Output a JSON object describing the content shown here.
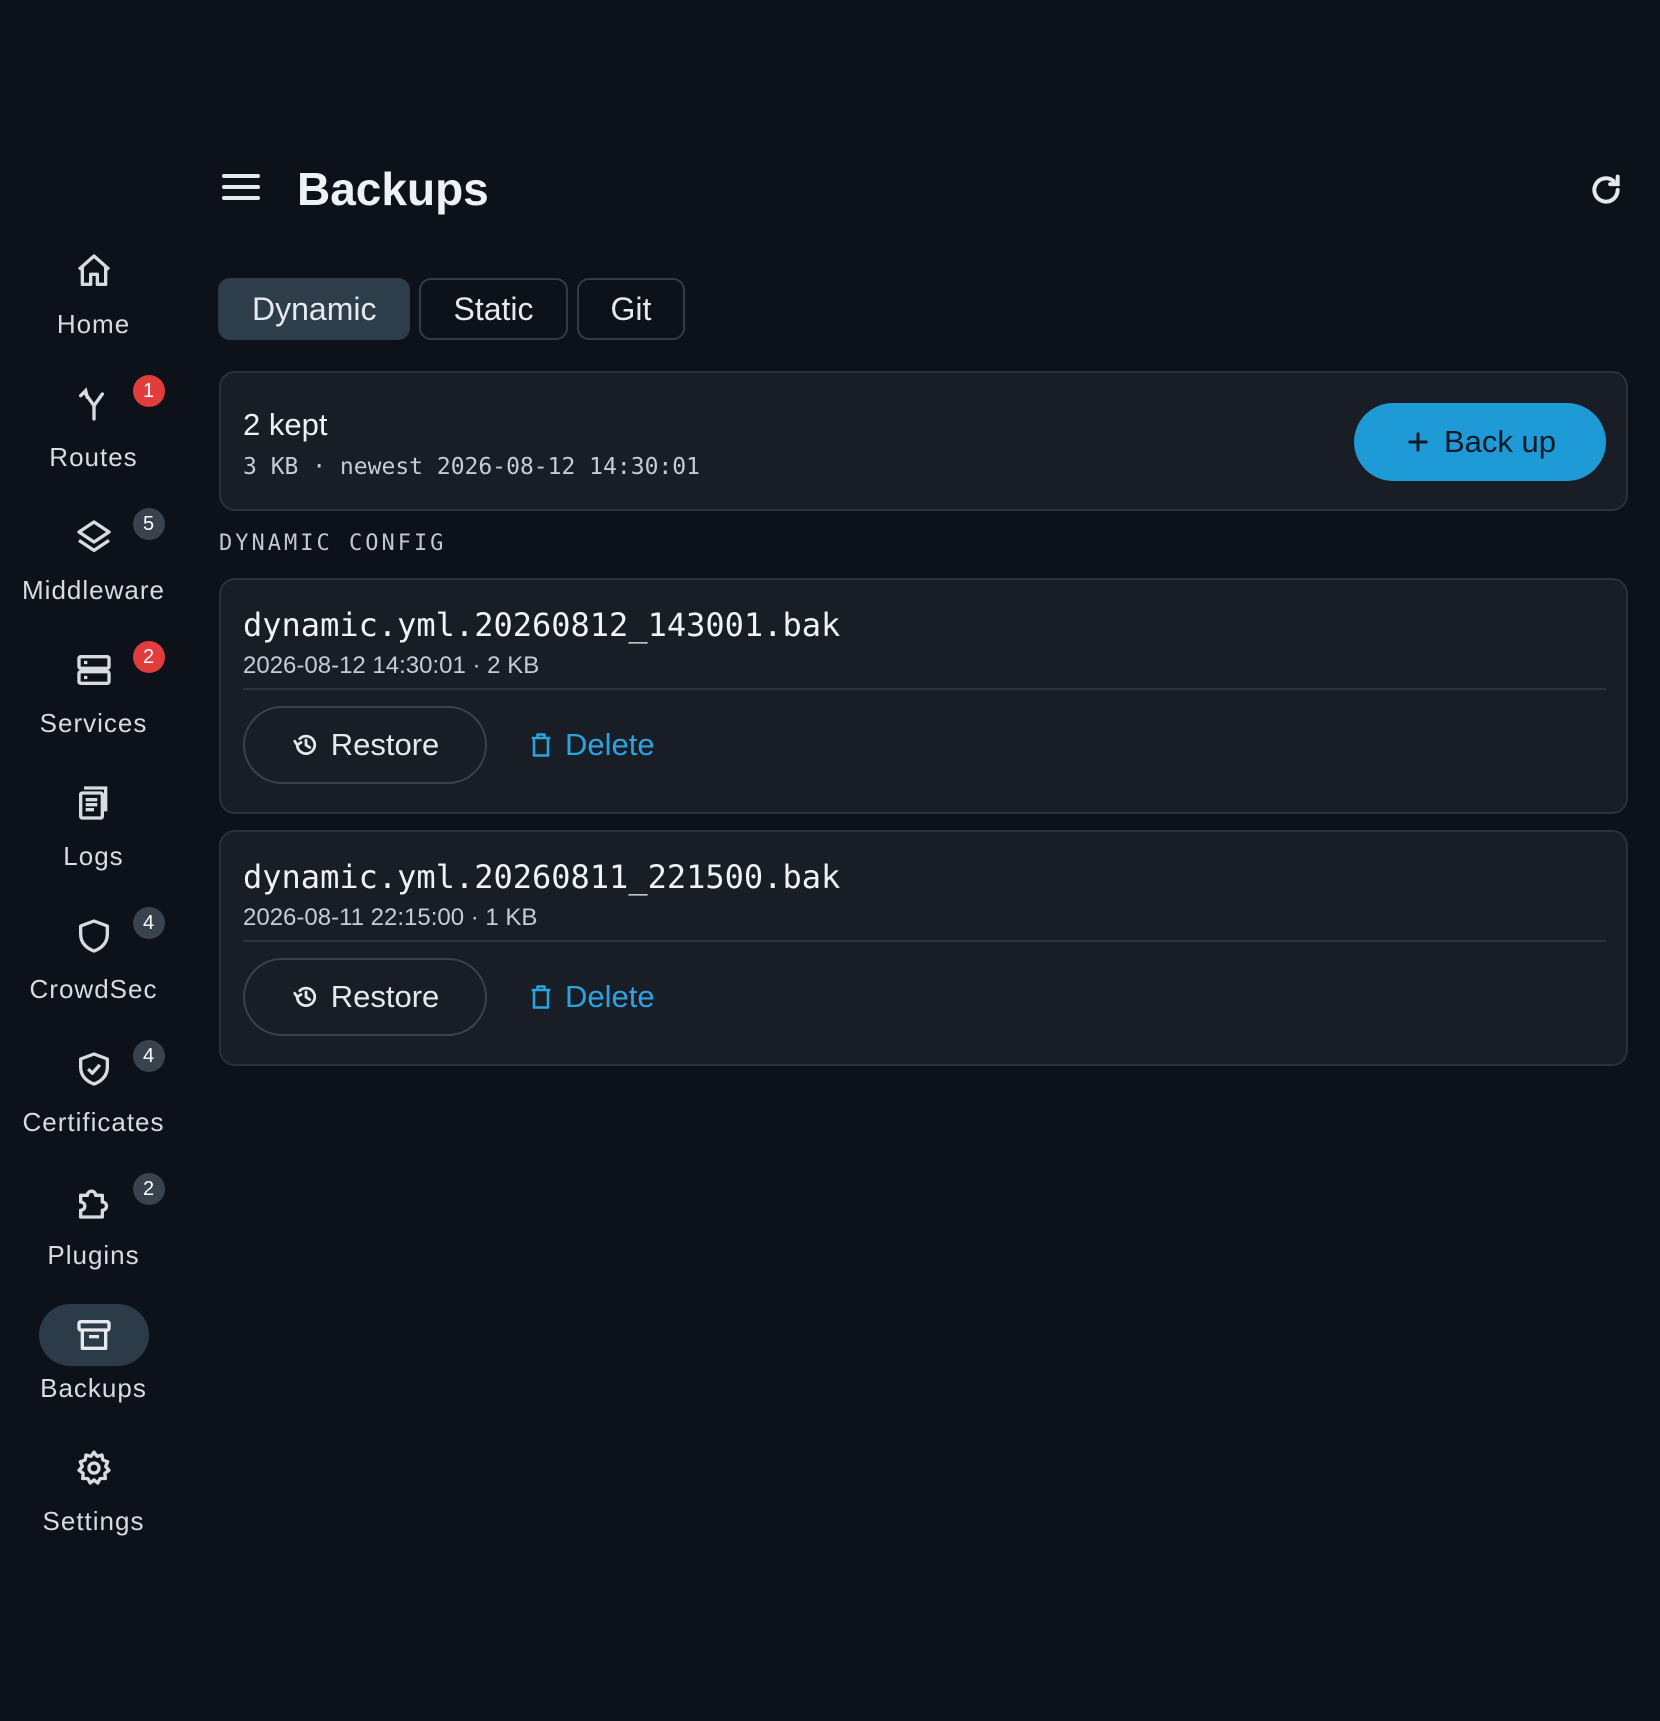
{
  "sidebar": {
    "items": [
      {
        "label": "Home",
        "icon": "home-icon",
        "badge": ""
      },
      {
        "label": "Routes",
        "icon": "routes-icon",
        "badge": "1"
      },
      {
        "label": "Middleware",
        "icon": "layers-icon",
        "badge": "5"
      },
      {
        "label": "Services",
        "icon": "server-icon",
        "badge": "2"
      },
      {
        "label": "Logs",
        "icon": "logs-icon",
        "badge": ""
      },
      {
        "label": "CrowdSec",
        "icon": "shield-icon",
        "badge": "4"
      },
      {
        "label": "Certificates",
        "icon": "shield-check-icon",
        "badge": "4"
      },
      {
        "label": "Plugins",
        "icon": "puzzle-icon",
        "badge": "2"
      },
      {
        "label": "Backups",
        "icon": "archive-icon",
        "badge": ""
      },
      {
        "label": "Settings",
        "icon": "gear-icon",
        "badge": ""
      }
    ],
    "active": "Backups"
  },
  "header": {
    "title": "Backups"
  },
  "tabs": [
    {
      "label": "Dynamic"
    },
    {
      "label": "Static"
    },
    {
      "label": "Git"
    }
  ],
  "summary": {
    "title": "2 kept",
    "subtitle": "3 KB · newest 2026-08-12 14:30:01",
    "backup_button": "Back up"
  },
  "section_label": "DYNAMIC CONFIG",
  "backups": [
    {
      "name": "dynamic.yml.20260812_143001.bak",
      "meta": "2026-08-12 14:30:01 · 2 KB",
      "restore_label": "Restore",
      "delete_label": "Delete"
    },
    {
      "name": "dynamic.yml.20260811_221500.bak",
      "meta": "2026-08-11 22:15:00 · 1 KB",
      "restore_label": "Restore",
      "delete_label": "Delete"
    }
  ],
  "colors": {
    "background": "#0d111a",
    "card": "#181d26",
    "accent": "#1e9ad6",
    "badge_red": "#e23d3d",
    "badge_gray": "#39434e"
  }
}
